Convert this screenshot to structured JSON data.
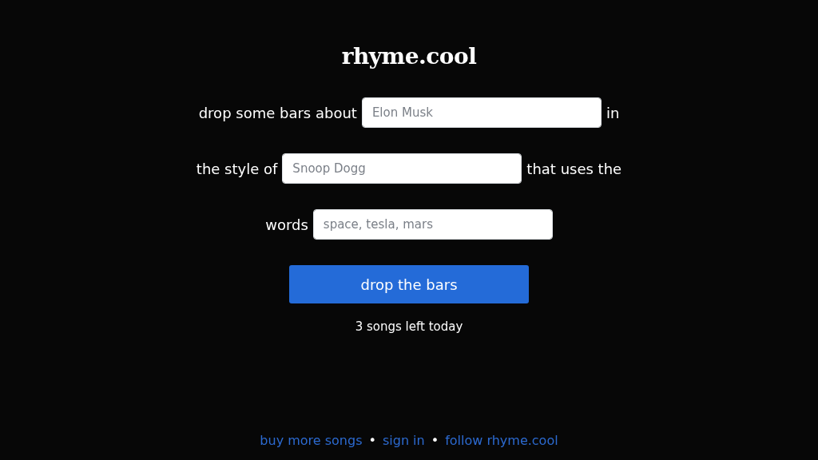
{
  "title": "rhyme.cool",
  "prompt_lines": [
    [
      {
        "kind": "text",
        "text": "drop some bars about"
      },
      {
        "kind": "field",
        "placeholder": "Elon Musk"
      },
      {
        "kind": "text",
        "text": "in"
      }
    ],
    [
      {
        "kind": "text",
        "text": "the style of"
      },
      {
        "kind": "field",
        "placeholder": "Snoop Dogg"
      },
      {
        "kind": "text",
        "text": "that uses the"
      }
    ],
    [
      {
        "kind": "text",
        "text": "words"
      },
      {
        "kind": "field",
        "placeholder": "space, tesla, mars"
      }
    ]
  ],
  "submit_button": "drop the bars",
  "quota": "3 songs left today",
  "footer": [
    {
      "kind": "link",
      "text": "buy more songs"
    },
    {
      "kind": "separator",
      "text": "•"
    },
    {
      "kind": "link",
      "text": "sign in"
    },
    {
      "kind": "separator",
      "text": "•"
    },
    {
      "kind": "link",
      "text": "follow rhyme.cool"
    }
  ]
}
